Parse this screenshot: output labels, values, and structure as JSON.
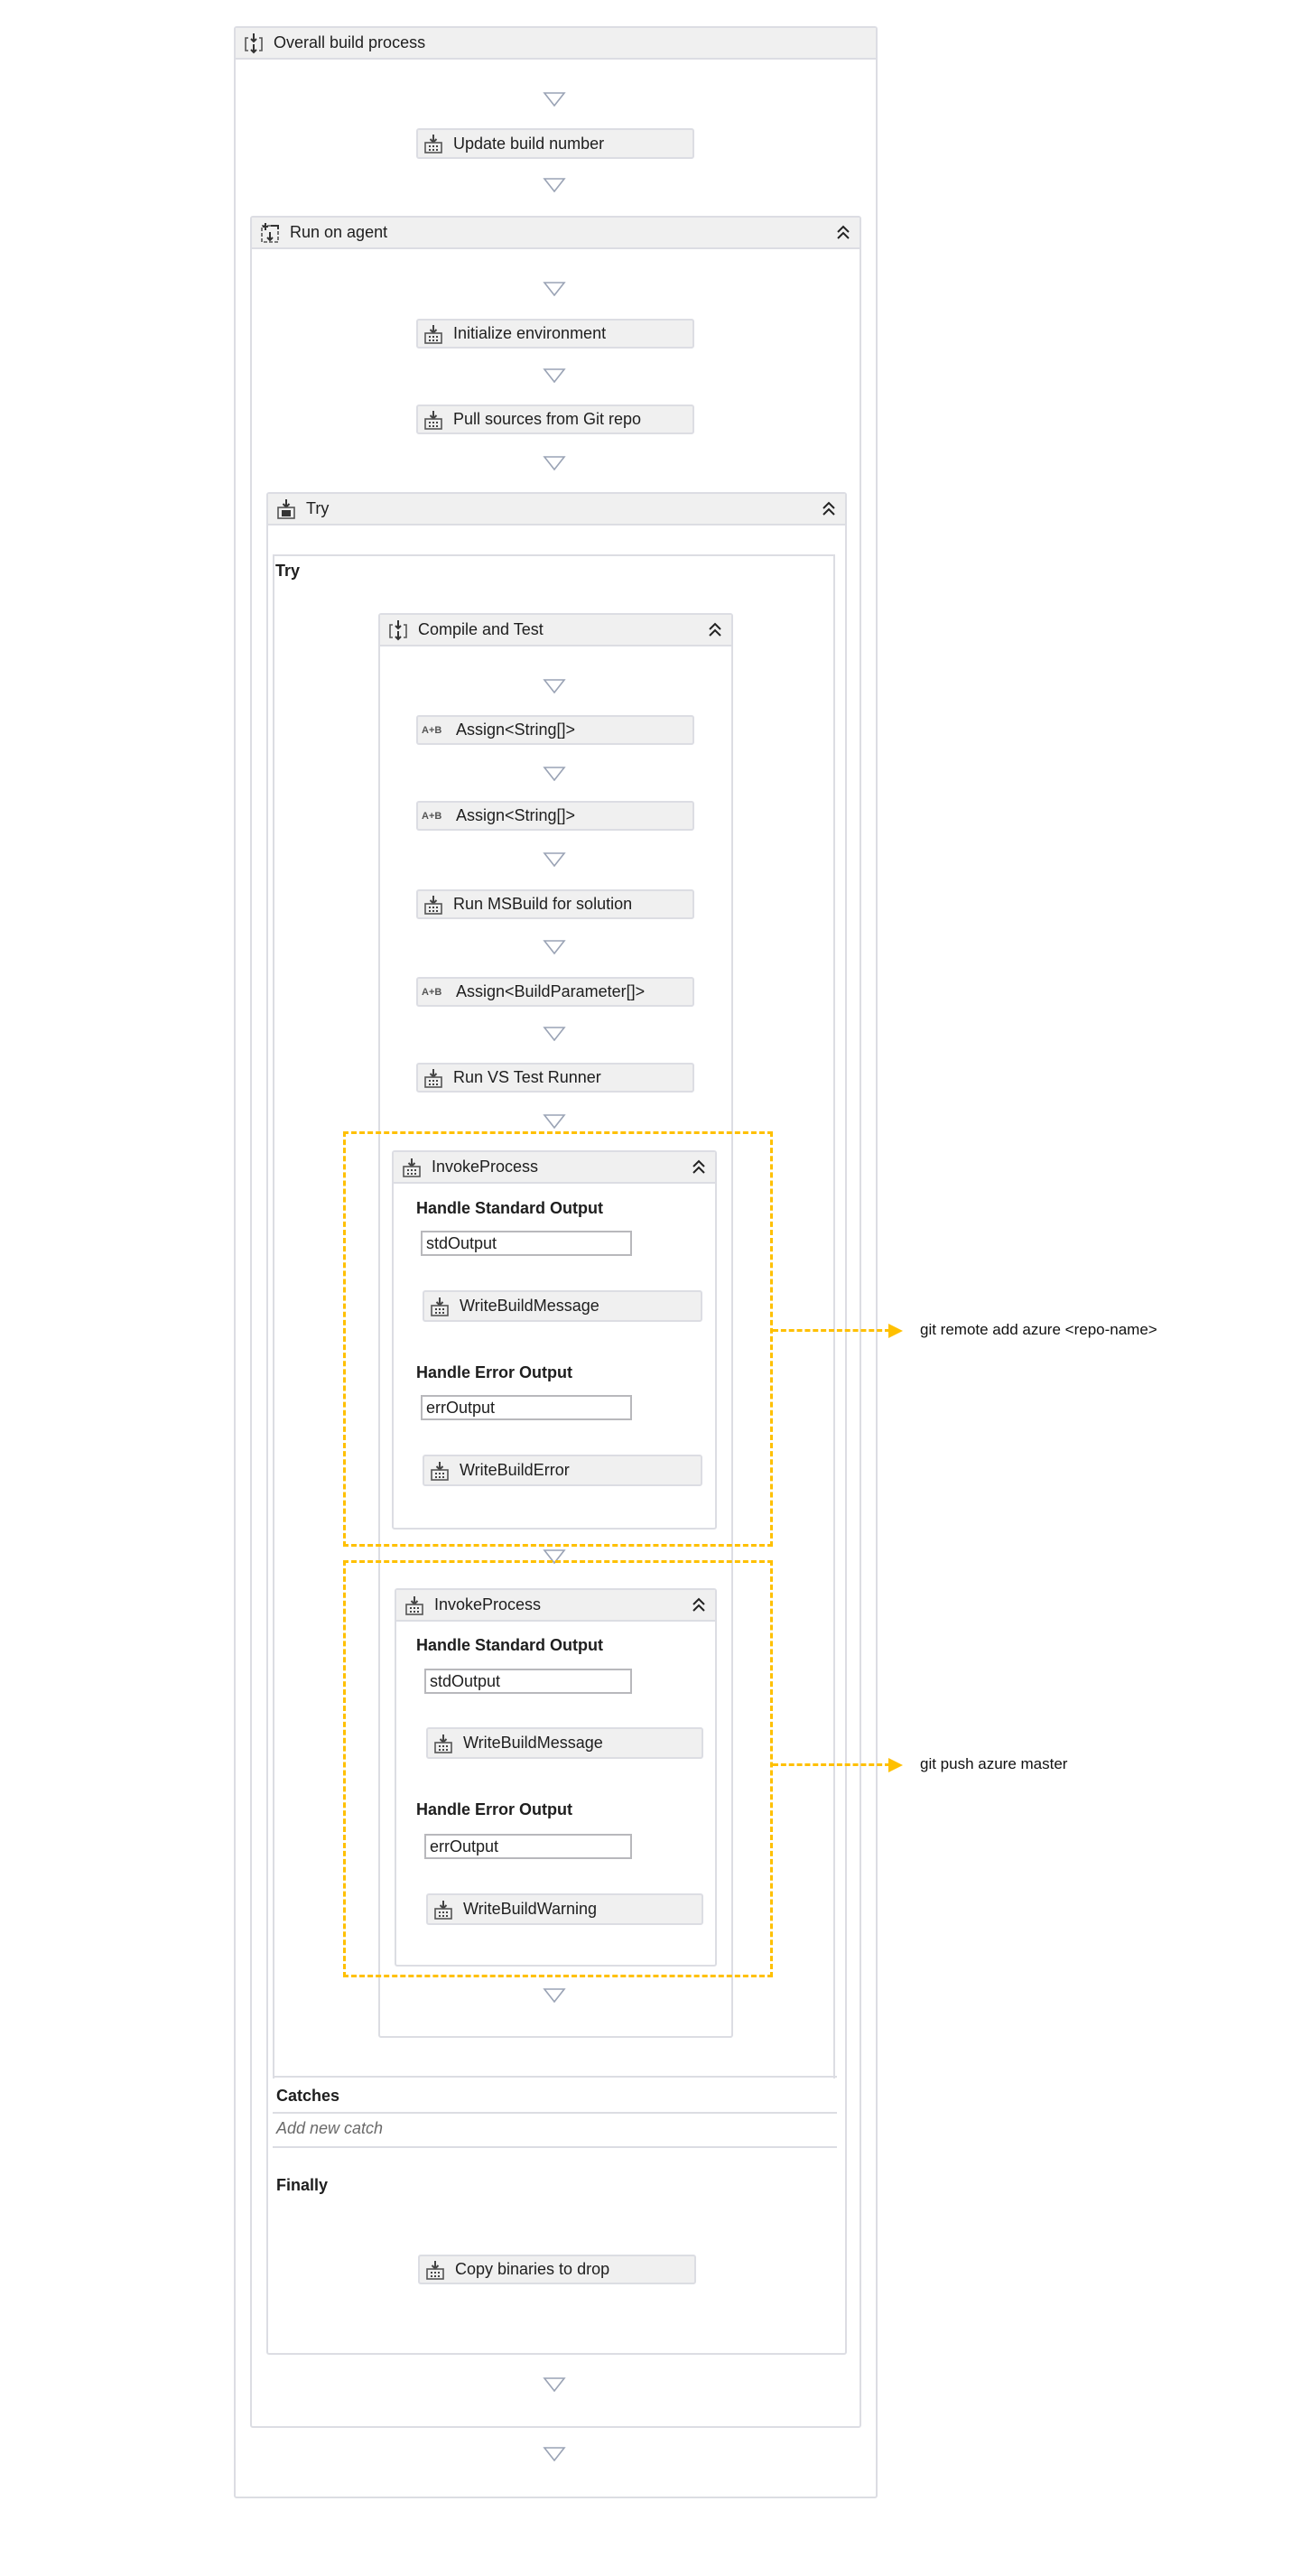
{
  "colors": {
    "accent_dashed": "#ffc000",
    "border": "#dcdde3",
    "header_bg": "#f0f0f0"
  },
  "overall": {
    "title": "Overall build process",
    "icon": "sequence-icon"
  },
  "update_build_number": {
    "label": "Update build number",
    "icon": "activity-icon"
  },
  "run_on_agent": {
    "title": "Run on agent",
    "icon": "agent-scope-icon",
    "initialize_environment": "Initialize environment",
    "pull_sources": "Pull sources from Git repo"
  },
  "try_block": {
    "title": "Try",
    "try_label": "Try",
    "compile_and_test": {
      "title": "Compile and Test",
      "activities": [
        {
          "label": "Assign<String[]>",
          "icon": "assign-icon",
          "icon_text": "A+B"
        },
        {
          "label": "Assign<String[]>",
          "icon": "assign-icon",
          "icon_text": "A+B"
        },
        {
          "label": "Run MSBuild for solution",
          "icon": "activity-icon"
        },
        {
          "label": "Assign<BuildParameter[]>",
          "icon": "assign-icon",
          "icon_text": "A+B"
        },
        {
          "label": "Run VS Test Runner",
          "icon": "activity-icon"
        }
      ],
      "invoke_processes": [
        {
          "title": "InvokeProcess",
          "std_heading": "Handle Standard Output",
          "std_value": "stdOutput",
          "std_activity": "WriteBuildMessage",
          "err_heading": "Handle Error Output",
          "err_value": "errOutput",
          "err_activity": "WriteBuildError",
          "annotation": "git remote add azure <repo-name>"
        },
        {
          "title": "InvokeProcess",
          "std_heading": "Handle Standard Output",
          "std_value": "stdOutput",
          "std_activity": "WriteBuildMessage",
          "err_heading": "Handle Error Output",
          "err_value": "errOutput",
          "err_activity": "WriteBuildWarning",
          "annotation": "git push azure master"
        }
      ]
    },
    "catches_label": "Catches",
    "add_new_catch": "Add new catch",
    "finally_label": "Finally",
    "copy_binaries": "Copy binaries to drop"
  }
}
